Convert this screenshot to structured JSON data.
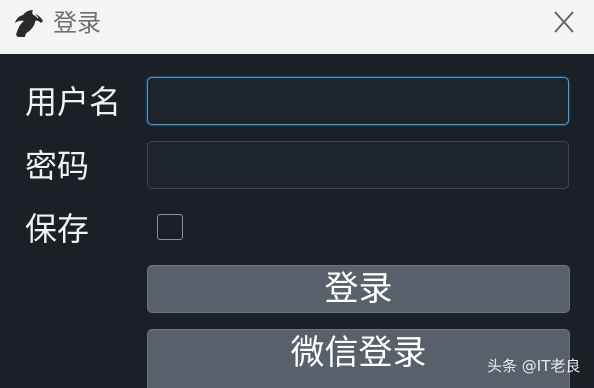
{
  "window": {
    "title": "登录"
  },
  "form": {
    "username_label": "用户名",
    "password_label": "密码",
    "save_label": "保存",
    "username_value": "",
    "password_value": "",
    "save_checked": false
  },
  "buttons": {
    "login_label": "登录",
    "wechat_login_label": "微信登录"
  },
  "watermark": {
    "text": "头条 @IT老良"
  },
  "colors": {
    "background": "#1b2027",
    "titlebar": "#f4f4f4",
    "button": "#58616b",
    "focus_border": "#4a9bd8"
  },
  "icons": {
    "logo": "horse-head-icon",
    "close": "close-icon"
  }
}
